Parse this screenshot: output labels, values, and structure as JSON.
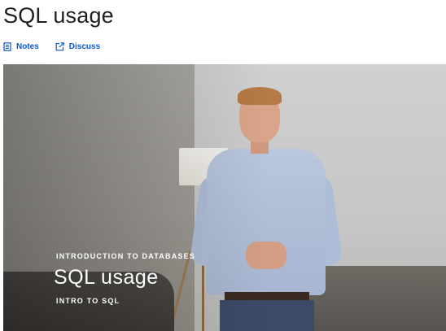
{
  "page": {
    "title": "SQL usage"
  },
  "actions": [
    {
      "label": "Notes",
      "icon": "notes-icon"
    },
    {
      "label": "Discuss",
      "icon": "external-link-icon"
    }
  ],
  "video": {
    "kicker": "INTRODUCTION TO DATABASES",
    "title": "SQL usage",
    "subtitle": "INTRO TO SQL"
  },
  "colors": {
    "link": "#0b57d0",
    "title_text": "#1f1f1f",
    "overlay_text": "#ffffff"
  }
}
